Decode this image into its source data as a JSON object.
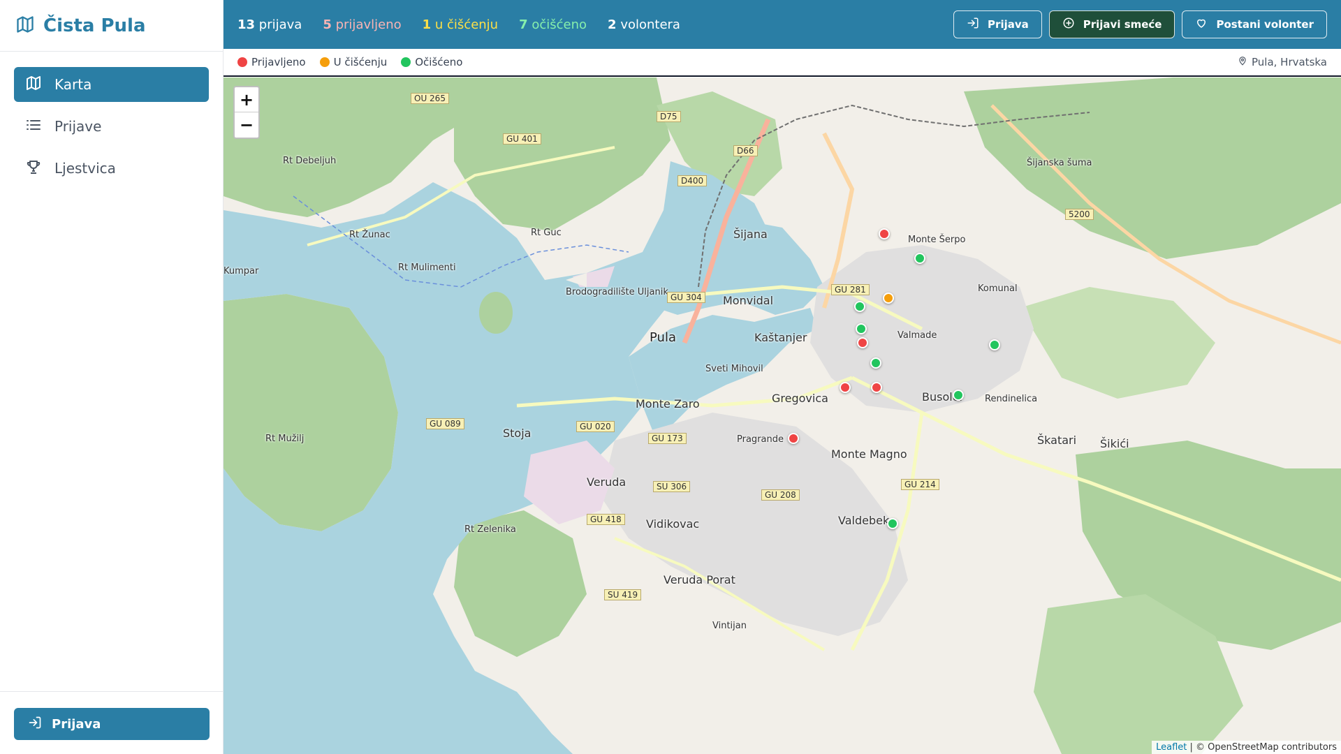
{
  "app": {
    "title": "Čista Pula"
  },
  "sidebar": {
    "items": [
      {
        "label": "Karta",
        "icon": "map-icon",
        "active": true
      },
      {
        "label": "Prijave",
        "icon": "list-icon",
        "active": false
      },
      {
        "label": "Ljestvica",
        "icon": "trophy-icon",
        "active": false
      }
    ],
    "footer_button": "Prijava"
  },
  "topbar": {
    "stats": [
      {
        "count": "13",
        "label": "prijava",
        "color": "#ffffff"
      },
      {
        "count": "5",
        "label": "prijavljeno",
        "color": "#f9b4b4"
      },
      {
        "count": "1",
        "label": "u čišćenju",
        "color": "#fde047"
      },
      {
        "count": "7",
        "label": "očišćeno",
        "color": "#86efac"
      },
      {
        "count": "2",
        "label": "volontera",
        "color": "#ffffff"
      }
    ],
    "buttons": {
      "login": "Prijava",
      "report": "Prijavi smeće",
      "volunteer": "Postani volonter"
    }
  },
  "legend": {
    "reported": "Prijavljeno",
    "cleaning": "U čišćenju",
    "cleaned": "Očišćeno",
    "location": "Pula, Hrvatska"
  },
  "colors": {
    "brand": "#2a7ea5",
    "reported": "#ef4444",
    "cleaning": "#f59e0b",
    "cleaned": "#22c55e"
  },
  "map": {
    "attribution_leaflet": "Leaflet",
    "attribution_osm": "| © OpenStreetMap contributors",
    "labels": {
      "pula": "Pula",
      "sijana": "Šijana",
      "monvidal": "Monvidal",
      "kastanjer": "Kaštanjer",
      "sveti_mihovil": "Sveti Mihovil",
      "gregovica": "Gregovica",
      "monte_zaro": "Monte Zaro",
      "stoja": "Stoja",
      "veruda": "Veruda",
      "vidikovac": "Vidikovac",
      "veruda_porat": "Veruda Porat",
      "valdebek": "Valdebek",
      "monte_magno": "Monte Magno",
      "busoler": "Busoler",
      "skatari": "Škatari",
      "valmade": "Valmade",
      "monte_serpo": "Monte Šerpo",
      "komunal": "Komunal",
      "pragrande": "Pragrande",
      "rendinelica": "Rendinelica",
      "sikici": "Šikići",
      "rt_debeljuh": "Rt Debeljuh",
      "rt_zunac": "Rt Žunac",
      "rt_guc": "Rt Guc",
      "rt_mulimenti": "Rt Mulimenti",
      "rt_zelenika": "Rt Zelenika",
      "rt_muzilj": "Rt Mužilj",
      "kumpar": "Kumpar",
      "brodogradiliste": "Brodogradilište Uljanik",
      "sijanska_suma": "Šijanska šuma",
      "vintijan": "Vintijan"
    },
    "roads": [
      "D75",
      "D66",
      "D400",
      "GU 401",
      "GU 304",
      "GU 281",
      "GU 020",
      "GU 089",
      "GU 173",
      "SU 306",
      "GU 208",
      "GU 214",
      "GU 418",
      "SU 419",
      "OU 265",
      "5200"
    ],
    "markers": [
      {
        "status": "reported",
        "lng_lat_note": ""
      },
      {
        "status": "cleaned"
      },
      {
        "status": "cleaning"
      },
      {
        "status": "cleaned"
      },
      {
        "status": "cleaned"
      },
      {
        "status": "reported"
      },
      {
        "status": "cleaned"
      },
      {
        "status": "reported"
      },
      {
        "status": "reported"
      },
      {
        "status": "cleaned"
      },
      {
        "status": "cleaned"
      },
      {
        "status": "reported"
      },
      {
        "status": "cleaned"
      }
    ]
  }
}
